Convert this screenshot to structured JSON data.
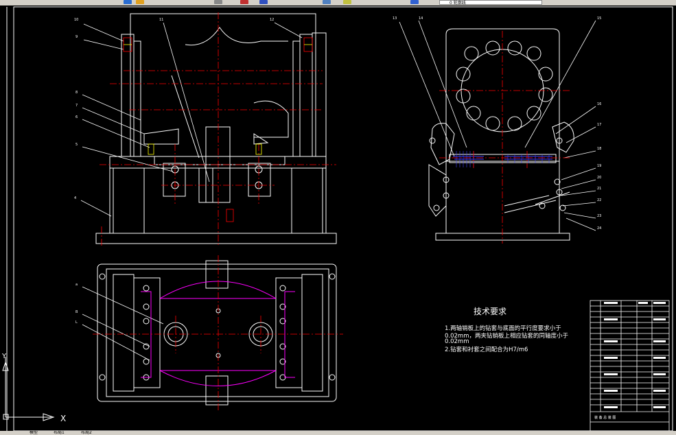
{
  "app": {
    "layer_control": {
      "value": "0 轮廓线"
    },
    "tabs": [
      "模型",
      "布局1",
      "布局2"
    ]
  },
  "drawing": {
    "front_view": {
      "part_numbers": [
        "10",
        "9",
        "8",
        "7",
        "6",
        "5",
        "4",
        "11",
        "12"
      ]
    },
    "side_view": {
      "part_numbers": [
        "13",
        "14",
        "15",
        "16",
        "17",
        "18",
        "19",
        "20",
        "21",
        "22",
        "23",
        "24",
        "25"
      ]
    },
    "plan_view": {
      "section_labels": [
        "a",
        "B",
        "L"
      ]
    },
    "technical_requirements": {
      "title": "技术要求",
      "lines": [
        "1.两轴销板上的钻套与底面的平行度要求小于",
        "0.02mm，两夹钻销板上相应钻套的同轴度小于",
        "0.02mm",
        "2.钻套和衬套之间配合为H7/m6"
      ]
    },
    "title_block": {
      "footer_label": "装 备 总 装 图"
    },
    "ucs": {
      "x": "X",
      "y": "Y"
    }
  },
  "colors": {
    "background": "#000000",
    "outline": "#ffffff",
    "centerline": "#ff0000",
    "hatch": "#ff00ff",
    "dimension": "#ff0000",
    "leader": "#ffffff",
    "thread": "#4040ff",
    "cyan": "#00ffff",
    "yellow": "#ffff00",
    "green": "#00ff00"
  }
}
